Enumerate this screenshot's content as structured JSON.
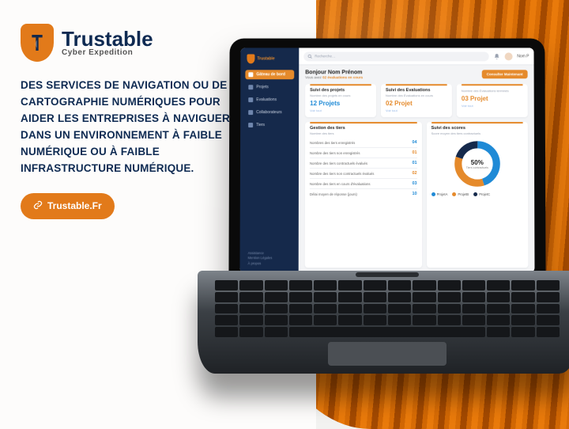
{
  "promo": {
    "brand_name": "Trustable",
    "brand_sub": "Cyber Expedition",
    "headline": "DES SERVICES DE NAVIGATION OU DE CARTOGRAPHIE NUMÉRIQUES POUR AIDER LES ENTREPRISES À NAVIGUER DANS UN ENVIRONNEMENT À FAIBLE NUMÉRIQUE OU À FAIBLE INFRASTRUCTURE NUMÉRIQUE.",
    "button_label": "Trustable.Fr"
  },
  "app": {
    "brand": "Trustable",
    "sidebar": {
      "items": [
        {
          "label": "Gâteau de bord",
          "icon": "grid-icon",
          "active": true
        },
        {
          "label": "Projets",
          "icon": "folder-icon",
          "active": false
        },
        {
          "label": "Evaluations",
          "icon": "chart-icon",
          "active": false
        },
        {
          "label": "Collaborateurs",
          "icon": "users-icon",
          "active": false
        },
        {
          "label": "Tiers",
          "icon": "building-icon",
          "active": false
        }
      ],
      "footer": [
        "Assistance",
        "Mention Légales",
        "À propos"
      ]
    },
    "topbar": {
      "search_placeholder": "Recherche…",
      "user_name": "Nom P"
    },
    "greeting": {
      "title": "Bonjour Nom Prénom",
      "sub_prefix": "Vous avez ",
      "sub_accent": "02 évaluations en cours",
      "cta": "Consulter Maintenant"
    },
    "summary_cards": [
      {
        "title": "Suivi des projets",
        "sub": "Nombre des projets en cours",
        "value": "12 Projets",
        "color": "blue",
        "link": "Voir tout"
      },
      {
        "title": "Suivi des Evaluations",
        "sub": "Nombre des Évaluations en cours",
        "value": "02 Projet",
        "color": "orange",
        "link": "Voir tout"
      },
      {
        "title": "",
        "sub": "Nombre des Évaluations terminés",
        "value": "03 Projet",
        "color": "orange",
        "link": "Voir tout"
      }
    ],
    "tiers_card": {
      "title": "Gestion des tiers",
      "sub": "Nombre des tiers",
      "rows": [
        {
          "label": "Nombres des tiers enregistrés",
          "value": "04",
          "color": "blue"
        },
        {
          "label": "Nombre des tiers non enregistrés",
          "value": "01",
          "color": "orange"
        },
        {
          "label": "Nombre des tiers contractuels évalués",
          "value": "01",
          "color": "blue"
        },
        {
          "label": "Nombre des tiers non contractuels évalués",
          "value": "02",
          "color": "orange"
        },
        {
          "label": "Nombre des tiers en cours d'évaluations",
          "value": "03",
          "color": "blue"
        },
        {
          "label": "Délai moyen de réponse (jours)",
          "value": "10",
          "color": "blue"
        }
      ]
    },
    "scores_card": {
      "title": "Suivi des scores",
      "sub": "Score moyen des tiers contractuels",
      "pct": "50%",
      "pct_label": "Tiers contractuels",
      "legend": [
        {
          "name": "ProjetA",
          "color": "#1f8ad6"
        },
        {
          "name": "ProjetB",
          "color": "#e58a2b"
        },
        {
          "name": "ProjetC",
          "color": "#15294b"
        }
      ]
    }
  },
  "chart_data": {
    "type": "pie",
    "title": "Suivi des scores",
    "series": [
      {
        "name": "ProjetA",
        "value": 45,
        "color": "#1f8ad6"
      },
      {
        "name": "ProjetB",
        "value": 35,
        "color": "#e58a2b"
      },
      {
        "name": "ProjetC",
        "value": 20,
        "color": "#15294b"
      }
    ],
    "center_label": "50% Tiers contractuels"
  }
}
